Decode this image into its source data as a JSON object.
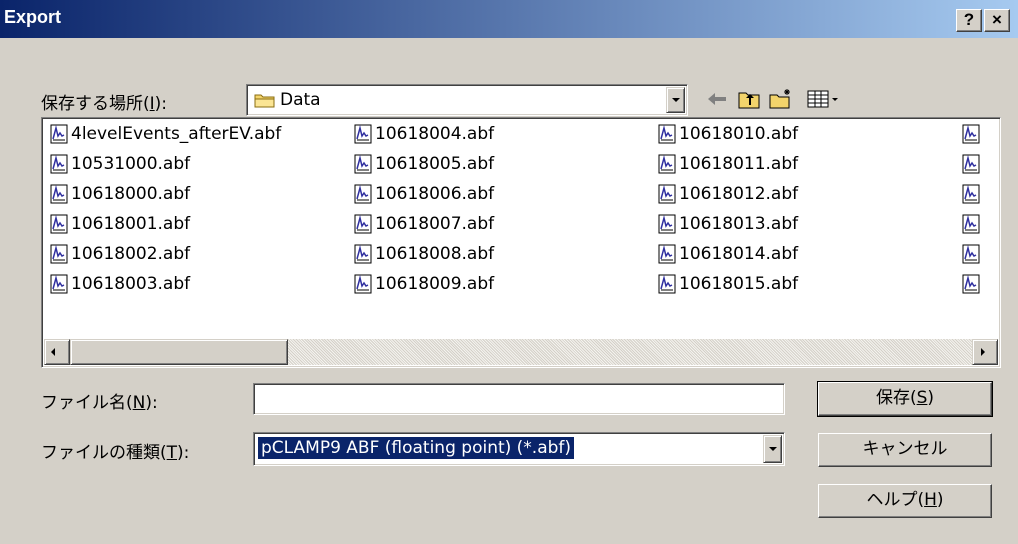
{
  "window": {
    "title": "Export",
    "help_button": "?",
    "close_button": "×"
  },
  "location": {
    "label_prefix": "保存する場所(",
    "label_key": "I",
    "label_suffix": "):",
    "value": "Data"
  },
  "files": {
    "col1": [
      "4levelEvents_afterEV.abf",
      "10531000.abf",
      "10618000.abf",
      "10618001.abf",
      "10618002.abf",
      "10618003.abf"
    ],
    "col2": [
      "10618004.abf",
      "10618005.abf",
      "10618006.abf",
      "10618007.abf",
      "10618008.abf",
      "10618009.abf"
    ],
    "col3": [
      "10618010.abf",
      "10618011.abf",
      "10618012.abf",
      "10618013.abf",
      "10618014.abf",
      "10618015.abf"
    ],
    "col4_partial_count": 6
  },
  "filename": {
    "label_prefix": "ファイル名(",
    "label_key": "N",
    "label_suffix": "):",
    "value": ""
  },
  "filetype": {
    "label_prefix": "ファイルの種類(",
    "label_key": "T",
    "label_suffix": "):",
    "value": "pCLAMP9 ABF (floating point) (*.abf)"
  },
  "buttons": {
    "save_prefix": "保存(",
    "save_key": "S",
    "save_suffix": ")",
    "cancel": "キャンセル",
    "help_prefix": "ヘルプ(",
    "help_key": "H",
    "help_suffix": ")"
  },
  "colors": {
    "titlebar_start": "#0a246a",
    "titlebar_end": "#a6caf0",
    "face": "#d4d0c8",
    "selection": "#0a246a"
  },
  "icons": [
    "folder-icon",
    "back-arrow-icon",
    "up-folder-icon",
    "new-folder-icon",
    "view-menu-icon",
    "abf-file-icon"
  ]
}
